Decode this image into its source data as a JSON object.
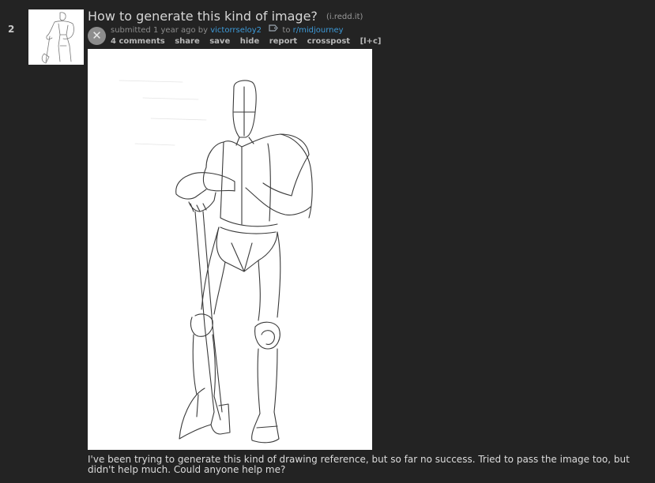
{
  "post": {
    "rank": "2",
    "title": "How to generate this kind of image?",
    "domain": "i.redd.it",
    "tagline": {
      "prefix": "submitted",
      "time": "1 year ago",
      "by": "by",
      "author": "victorrseloy2",
      "to": "to",
      "subreddit": "r/midjourney"
    },
    "actions": {
      "comments": "4 comments",
      "share": "share",
      "save": "save",
      "hide": "hide",
      "report": "report",
      "crosspost": "crosspost",
      "lc": "[l+c]"
    },
    "collapse_symbol": "✕",
    "selftext": "I've been trying to generate this kind of drawing reference, but so far no success. Tried to pass the image too, but didn't help much. Could anyone help me?"
  },
  "colors": {
    "background": "#232323",
    "link": "#3d9ad8",
    "title": "#d6d6d6"
  },
  "icons": {
    "collapse": "close-icon",
    "tag": "tag-icon"
  }
}
